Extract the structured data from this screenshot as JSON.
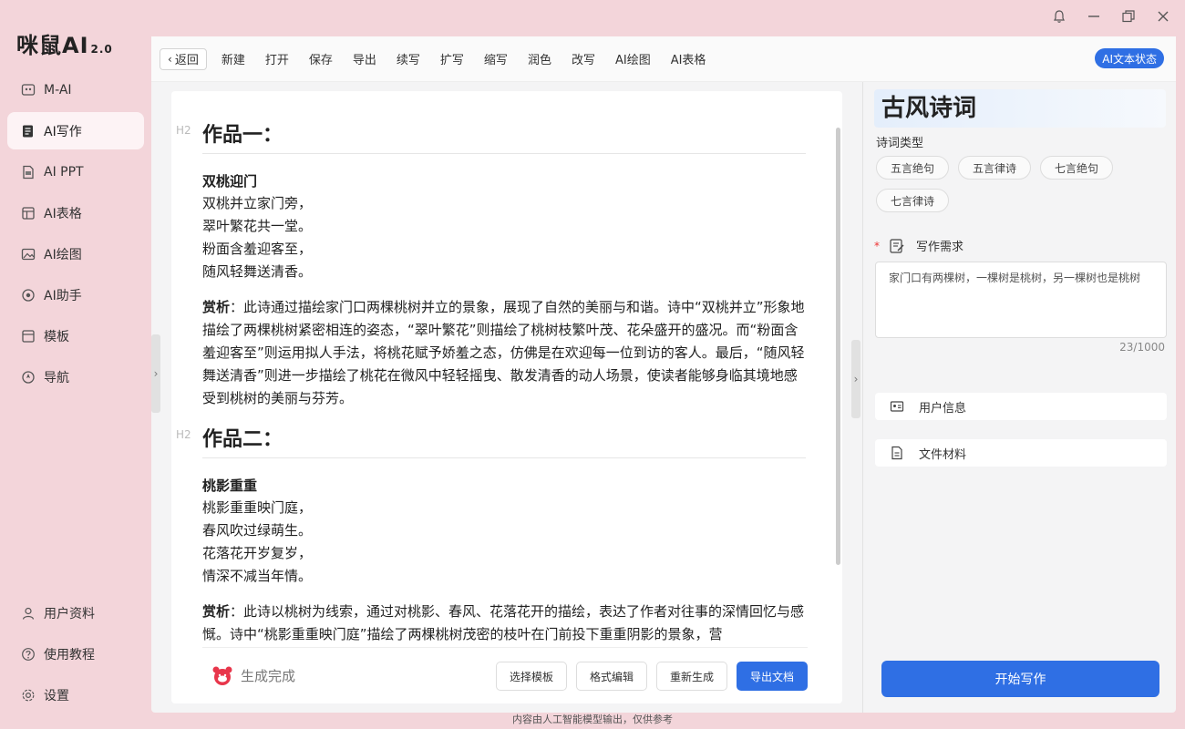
{
  "app": {
    "logo": "咪鼠AI",
    "version": "2.0"
  },
  "sidebar": {
    "items": [
      {
        "label": "M-AI",
        "icon": "m-ai-icon"
      },
      {
        "label": "AI写作",
        "icon": "write-icon",
        "active": true
      },
      {
        "label": "AI PPT",
        "icon": "ppt-icon"
      },
      {
        "label": "AI表格",
        "icon": "table-icon"
      },
      {
        "label": "AI绘图",
        "icon": "image-icon"
      },
      {
        "label": "AI助手",
        "icon": "assistant-icon"
      },
      {
        "label": "模板",
        "icon": "template-icon"
      },
      {
        "label": "导航",
        "icon": "navigation-icon"
      }
    ],
    "bottom": [
      {
        "label": "用户资料",
        "icon": "user-icon"
      },
      {
        "label": "使用教程",
        "icon": "help-icon"
      },
      {
        "label": "设置",
        "icon": "settings-icon"
      }
    ]
  },
  "toolbar": {
    "back": "返回",
    "items": [
      "新建",
      "打开",
      "保存",
      "导出",
      "续写",
      "扩写",
      "缩写",
      "润色",
      "改写",
      "AI绘图",
      "AI表格"
    ],
    "ai_status": "AI文本状态"
  },
  "document": {
    "sections": [
      {
        "tag": "H2",
        "heading": "作品一：",
        "poem_title": "双桃迎门",
        "lines": [
          "双桃并立家门旁，",
          "翠叶繁花共一堂。",
          "粉面含羞迎客至，",
          "随风轻舞送清香。"
        ],
        "appr_label": "赏析",
        "appr_text": "：此诗通过描绘家门口两棵桃树并立的景象，展现了自然的美丽与和谐。诗中“双桃并立”形象地描绘了两棵桃树紧密相连的姿态，“翠叶繁花”则描绘了桃树枝繁叶茂、花朵盛开的盛况。而“粉面含羞迎客至”则运用拟人手法，将桃花赋予娇羞之态，仿佛是在欢迎每一位到访的客人。最后，“随风轻舞送清香”则进一步描绘了桃花在微风中轻轻摇曳、散发清香的动人场景，使读者能够身临其境地感受到桃树的美丽与芬芳。"
      },
      {
        "tag": "H2",
        "heading": "作品二：",
        "poem_title": "桃影重重",
        "lines": [
          "桃影重重映门庭，",
          "春风吹过绿萌生。",
          "花落花开岁复岁，",
          "情深不减当年情。"
        ],
        "appr_label": "赏析",
        "appr_text": "：此诗以桃树为线索，通过对桃影、春风、花落花开的描绘，表达了作者对往事的深情回忆与感慨。诗中“桃影重重映门庭”描绘了两棵桃树茂密的枝叶在门前投下重重阴影的景象，营"
      }
    ],
    "status": "生成完成",
    "buttons": [
      "选择模板",
      "格式编辑",
      "重新生成",
      "导出文档"
    ]
  },
  "panel": {
    "title": "古风诗词",
    "type_label": "诗词类型",
    "types": [
      "五言绝句",
      "五言律诗",
      "七言绝句",
      "七言律诗"
    ],
    "req_star": "*",
    "req_label": "写作需求",
    "req_value": "家门口有两棵树，一棵树是桃树，另一棵树也是桃树",
    "counter": "23/1000",
    "user_info": "用户信息",
    "file_material": "文件材料",
    "start": "开始写作"
  },
  "footer_note": "内容由人工智能模型输出，仅供参考",
  "colors": {
    "accent": "#2f6fe4",
    "window_bg": "#f3d5da"
  }
}
